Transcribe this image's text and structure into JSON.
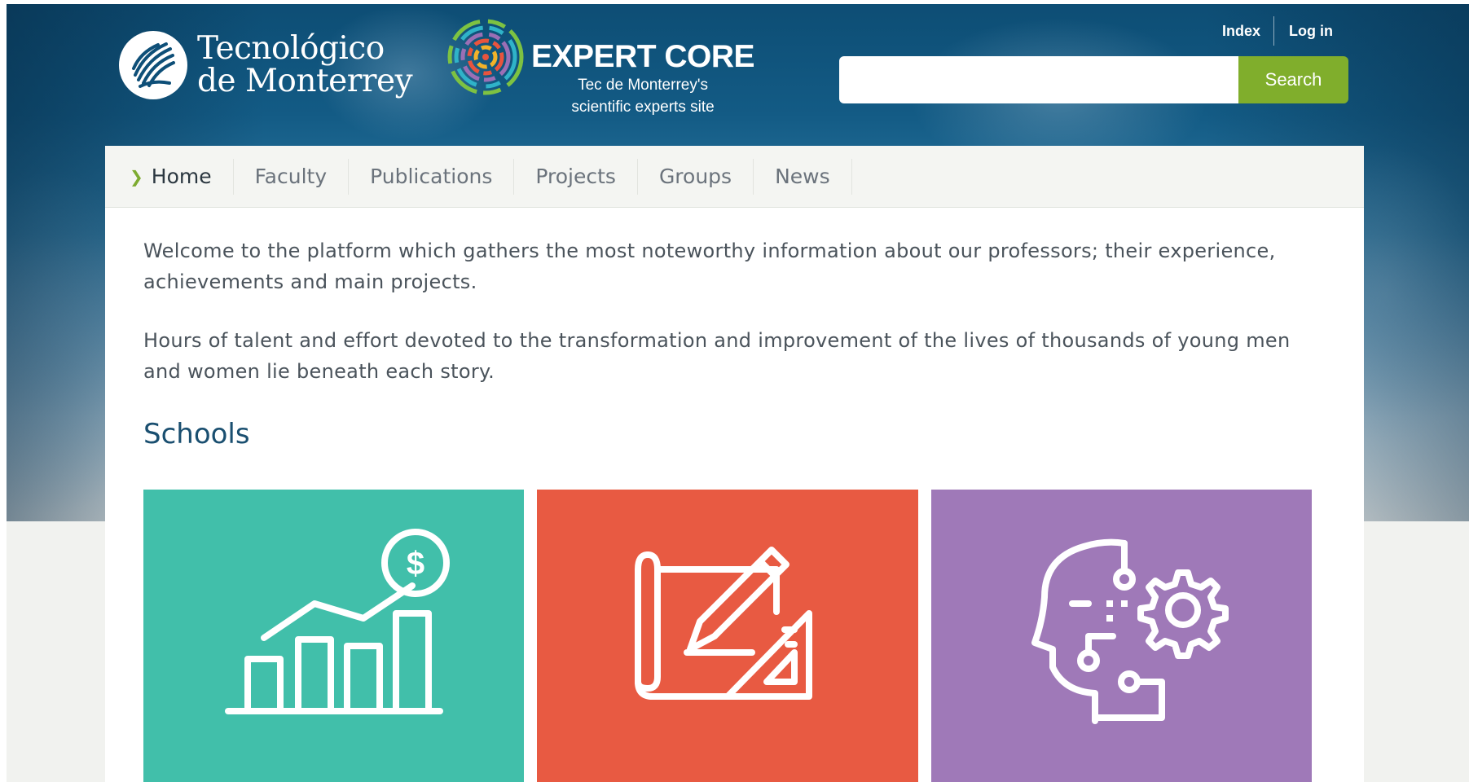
{
  "header": {
    "brand": {
      "name_line1": "Tecnológico",
      "name_line2": "de Monterrey"
    },
    "expert_core": {
      "title": "EXPERT CORE",
      "subtitle_line1": "Tec de Monterrey's",
      "subtitle_line2": "scientific experts site"
    },
    "links": {
      "index": "Index",
      "login": "Log in"
    },
    "search": {
      "value": "",
      "button_label": "Search"
    }
  },
  "nav": {
    "items": [
      {
        "label": "Home",
        "active": true
      },
      {
        "label": "Faculty"
      },
      {
        "label": "Publications"
      },
      {
        "label": "Projects"
      },
      {
        "label": "Groups"
      },
      {
        "label": "News"
      }
    ]
  },
  "main": {
    "intro_1": "Welcome to the platform which gathers the most noteworthy information about our professors; their experience, achievements and main projects.",
    "intro_2": "Hours of talent and effort devoted to the transformation and improvement of the lives of thousands of young men and women lie beneath each story.",
    "schools_heading": "Schools",
    "school_tiles": [
      {
        "icon": "business-growth-chart-icon",
        "color": "#41bfaa"
      },
      {
        "icon": "architecture-design-icon",
        "color": "#e85a42"
      },
      {
        "icon": "ai-head-gear-icon",
        "color": "#9f79b8"
      }
    ]
  },
  "colors": {
    "header_blue": "#0d4d74",
    "search_green": "#80ae2c",
    "nav_active_chevron": "#7dab30",
    "heading_blue": "#1a4f70"
  }
}
